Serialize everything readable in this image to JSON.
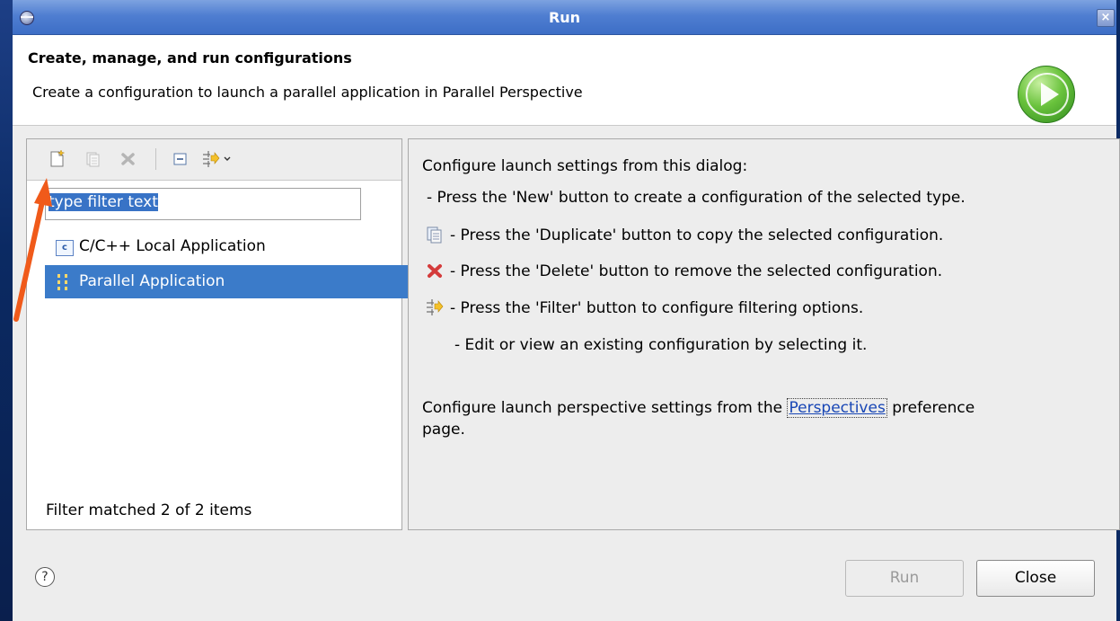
{
  "window": {
    "title": "Run",
    "close_symbol": "×"
  },
  "header": {
    "title": "Create, manage, and run configurations",
    "subtitle": "Create a configuration to launch a parallel application in Parallel Perspective",
    "logo_icon": "run-launch-icon"
  },
  "toolbar": {
    "buttons": [
      {
        "name": "new-configuration-icon",
        "enabled": true
      },
      {
        "name": "duplicate-icon",
        "enabled": false
      },
      {
        "name": "delete-icon",
        "enabled": false
      },
      {
        "name": "collapse-all-icon",
        "enabled": true
      },
      {
        "name": "filter-icon",
        "enabled": true
      },
      {
        "name": "chevron-down-icon",
        "enabled": true
      }
    ]
  },
  "filter": {
    "value": "type filter text",
    "status": "Filter matched 2 of 2 items"
  },
  "tree": {
    "items": [
      {
        "label": "C/C++ Local Application",
        "icon": "c-application-icon",
        "selected": false
      },
      {
        "label": "Parallel Application",
        "icon": "parallel-application-icon",
        "selected": true
      }
    ]
  },
  "info": {
    "heading": "Configure launch settings from this dialog:",
    "lines": [
      "- Press the 'New' button to create a configuration of the selected type.",
      "- Press the 'Duplicate' button to copy the selected configuration.",
      "- Press the 'Delete' button to remove the selected configuration.",
      "- Press the 'Filter' button to configure filtering options.",
      "- Edit or view an existing configuration by selecting it."
    ],
    "perspective_before": "Configure launch perspective settings from the",
    "perspective_link": "Perspectives",
    "perspective_after": "preference",
    "perspective_after2": "page."
  },
  "footer": {
    "help_symbol": "?",
    "run_label": "Run",
    "close_label": "Close"
  },
  "colors": {
    "selection": "#3b7bc9",
    "titlebar": "#4f7ed1",
    "annotation_arrow": "#f05a1a"
  }
}
